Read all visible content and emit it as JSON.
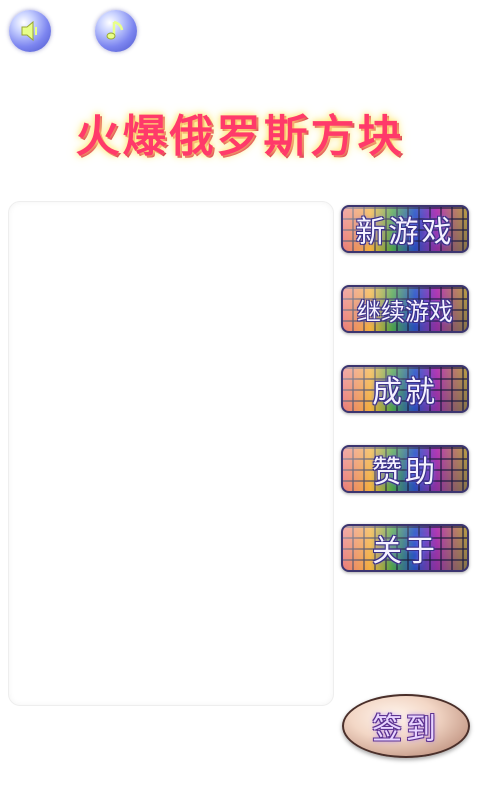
{
  "header": {
    "sound_icon": "speaker-icon",
    "music_icon": "music-note-icon"
  },
  "title": "火爆俄罗斯方块",
  "menu": {
    "new_game": "新游戏",
    "continue_game": "继续游戏",
    "achievements": "成就",
    "sponsor": "赞助",
    "about": "关于"
  },
  "signin": "签到",
  "colors": {
    "title": "#ff3a6a",
    "title_glow": "#ffe97a",
    "icon_blue": "#7d86f0",
    "button_border": "#3c3570"
  }
}
